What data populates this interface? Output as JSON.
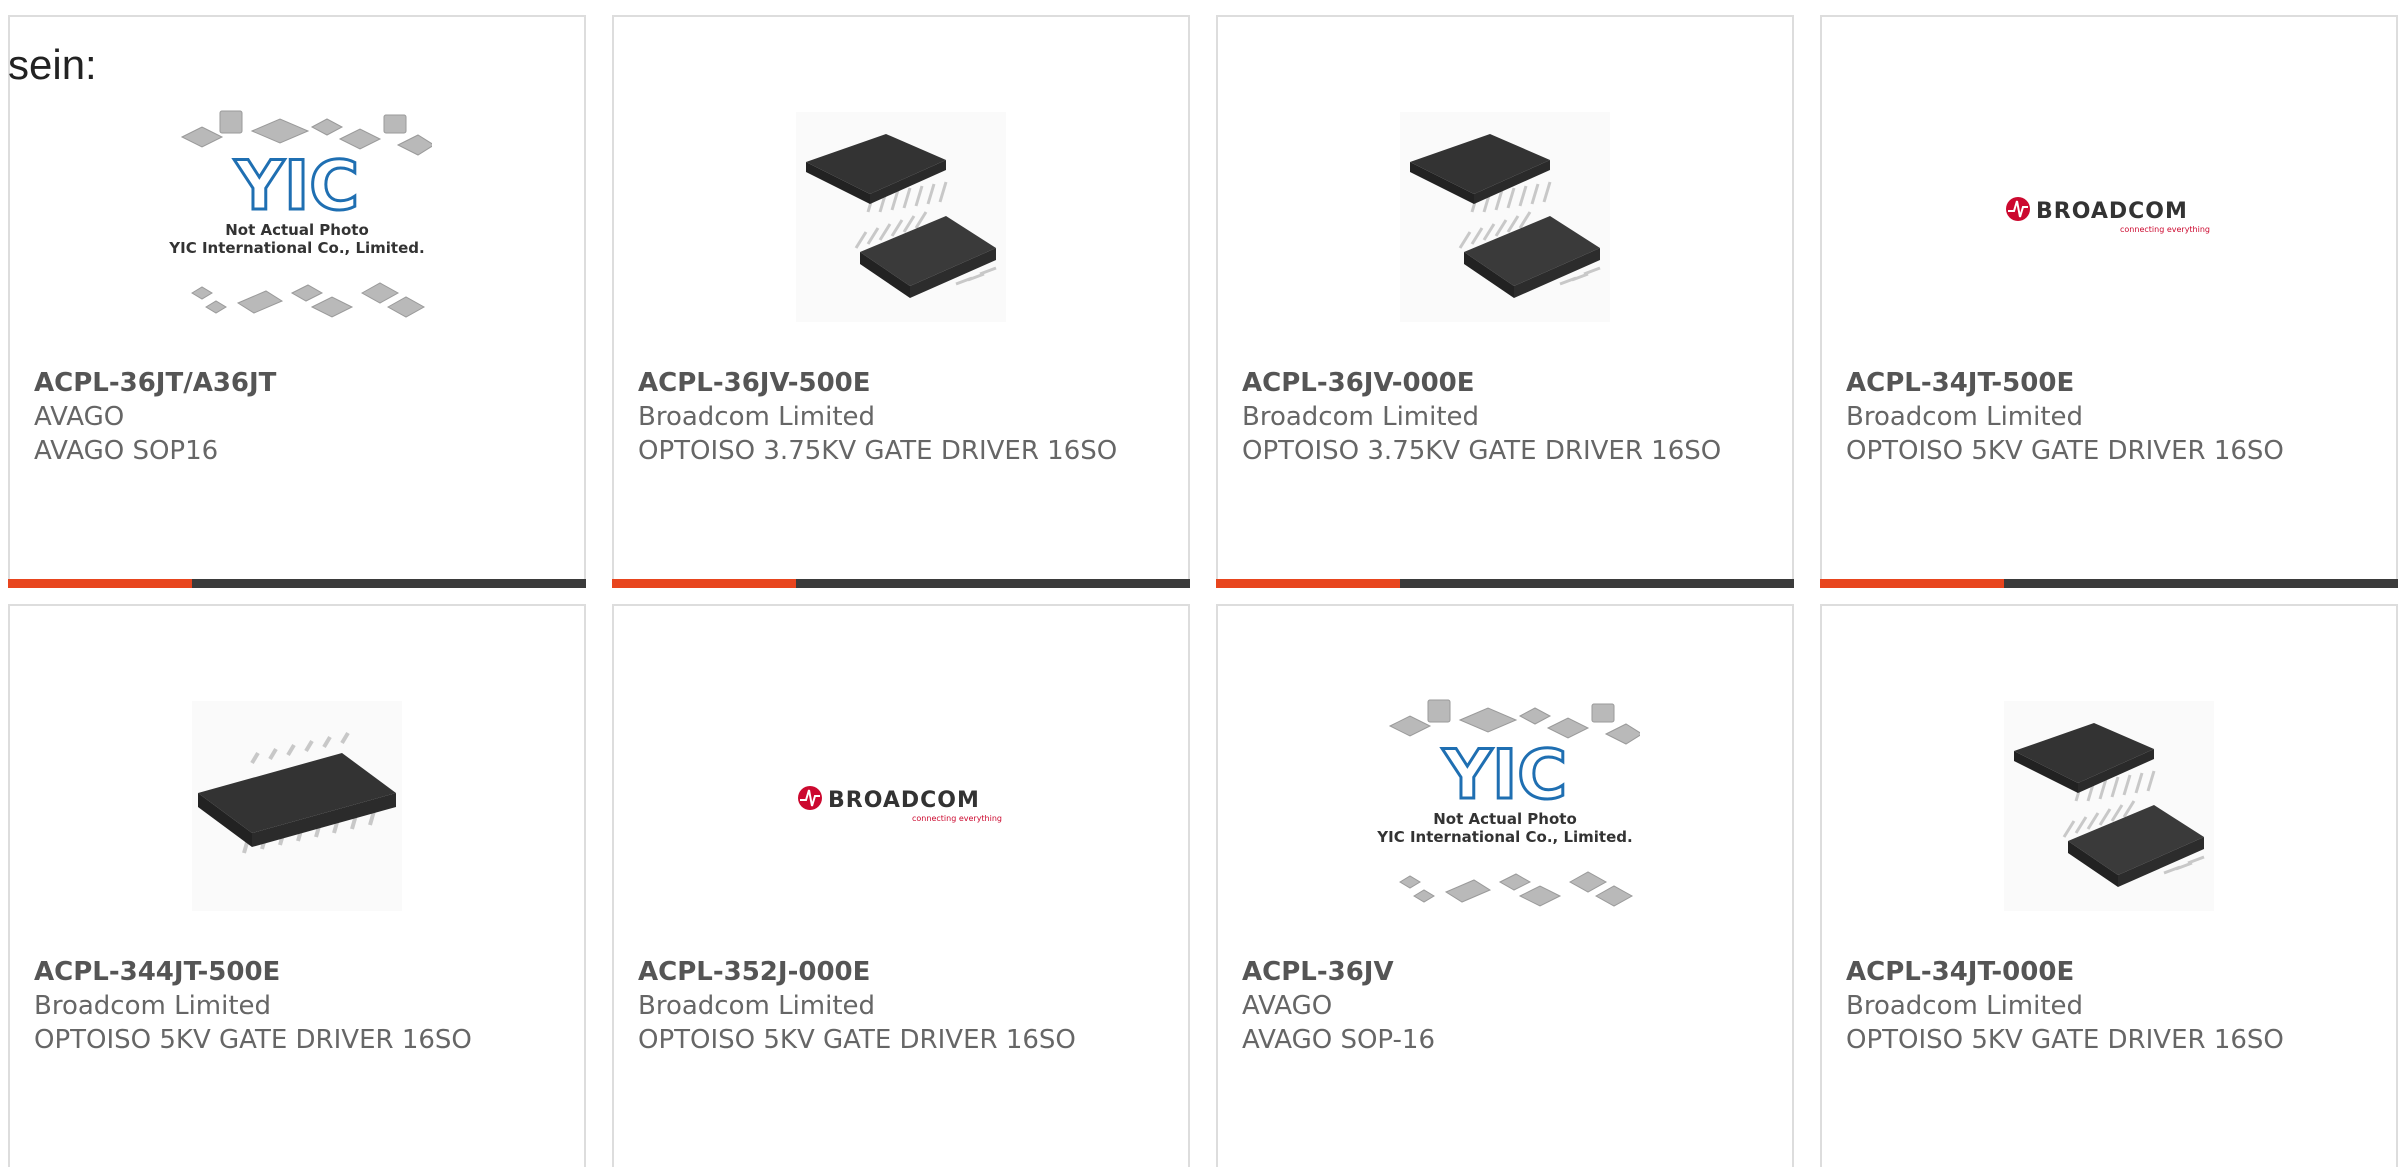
{
  "page": {
    "heading": "sein:"
  },
  "products": [
    {
      "part_number": "ACPL-36JT/A36JT",
      "manufacturer": "AVAGO",
      "description": "AVAGO SOP16",
      "image": "placeholder-chips-image",
      "image_caption": [
        "Not Actual Photo",
        "YIC International Co., Limited."
      ],
      "logo_text": "YIC"
    },
    {
      "part_number": "ACPL-36JV-500E",
      "manufacturer": "Broadcom Limited",
      "description": "OPTOISO 3.75KV GATE DRIVER 16SO",
      "image": "ssop16-pair-photo"
    },
    {
      "part_number": "ACPL-36JV-000E",
      "manufacturer": "Broadcom Limited",
      "description": "OPTOISO 3.75KV GATE DRIVER 16SO",
      "image": "ssop16-pair-photo"
    },
    {
      "part_number": "ACPL-34JT-500E",
      "manufacturer": "Broadcom Limited",
      "description": "OPTOISO 5KV GATE DRIVER 16SO",
      "image": "broadcom-logo",
      "logo_text": "BROADCOM",
      "logo_tagline": "connecting everything"
    },
    {
      "part_number": "ACPL-344JT-500E",
      "manufacturer": "Broadcom Limited",
      "description": "OPTOISO 5KV GATE DRIVER 16SO",
      "image": "soic16-photo"
    },
    {
      "part_number": "ACPL-352J-000E",
      "manufacturer": "Broadcom Limited",
      "description": "OPTOISO 5KV GATE DRIVER 16SO",
      "image": "broadcom-logo",
      "logo_text": "BROADCOM",
      "logo_tagline": "connecting everything"
    },
    {
      "part_number": "ACPL-36JV",
      "manufacturer": "AVAGO",
      "description": "AVAGO SOP-16",
      "image": "placeholder-chips-image",
      "image_caption": [
        "Not Actual Photo",
        "YIC International Co., Limited."
      ],
      "logo_text": "YIC"
    },
    {
      "part_number": "ACPL-34JT-000E",
      "manufacturer": "Broadcom Limited",
      "description": "OPTOISO 5KV GATE DRIVER 16SO",
      "image": "ssop16-pair-photo"
    }
  ],
  "colors": {
    "accent": "#e8451e",
    "bar": "#3b3b3b",
    "text": "#666666",
    "border": "#dddddd",
    "broadcom_red": "#cc092f",
    "yic_blue": "#1f6fb2"
  }
}
